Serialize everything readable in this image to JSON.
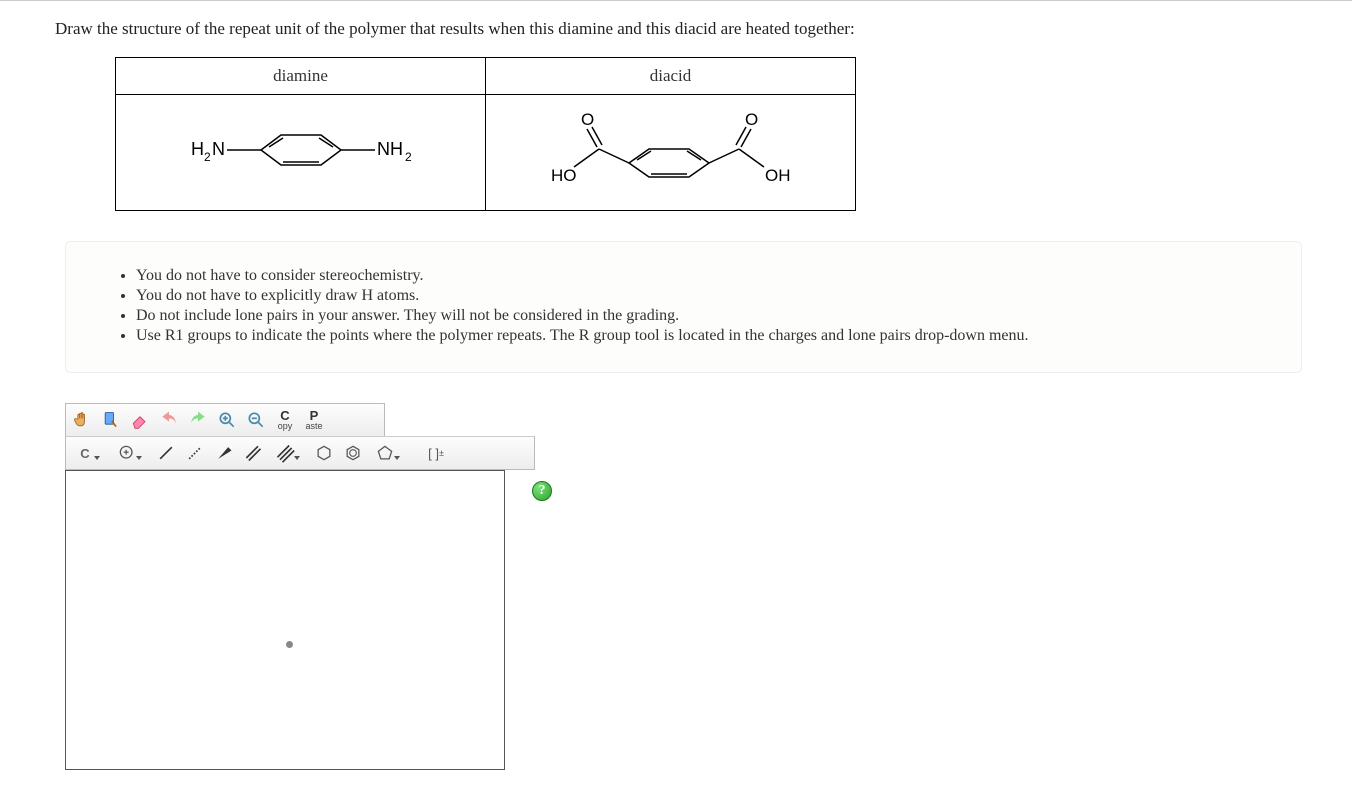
{
  "question": "Draw the structure of the repeat unit of the polymer that results when this diamine and this diacid are heated together:",
  "table": {
    "col1": "diamine",
    "col2": "diacid"
  },
  "instructions": [
    "You do not have to consider stereochemistry.",
    "You do not have to explicitly draw H atoms.",
    "Do not include lone pairs in your answer. They will not be considered in the grading.",
    "Use R1 groups to indicate the points where the polymer repeats. The R group tool is located in the charges and lone pairs drop-down menu."
  ],
  "toolbar": {
    "copy_top": "C",
    "copy_bottom": "opy",
    "paste_top": "P",
    "paste_bottom": "aste",
    "element": "C"
  },
  "help": "?"
}
